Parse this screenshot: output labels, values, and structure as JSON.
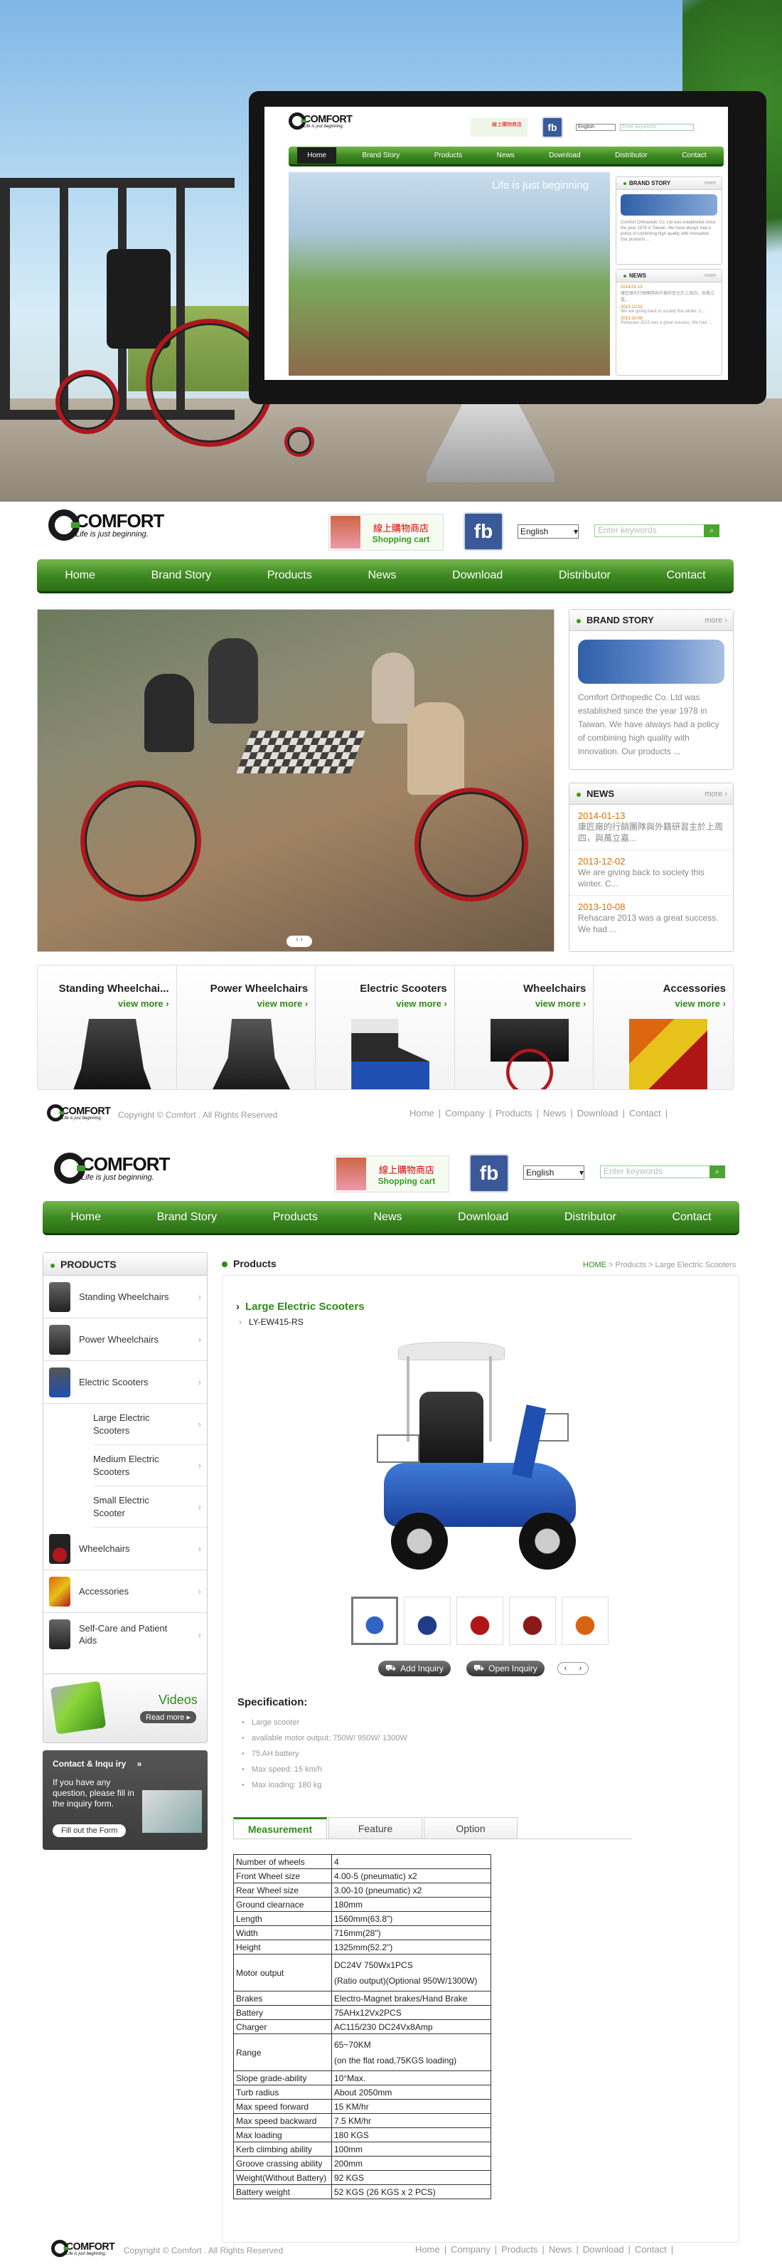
{
  "site": {
    "brand": "COMFORT",
    "slogan": "Life is just beginning.",
    "shop_line1": "線上購物商店",
    "shop_line2": "Shopping cart",
    "fb": "fb",
    "lang": "English",
    "search_placeholder": "Enter keywords"
  },
  "nav": [
    "Home",
    "Brand Story",
    "Products",
    "News",
    "Download",
    "Distributor",
    "Contact"
  ],
  "hero_screen": {
    "banner_text": "Life is just beginning",
    "brand_story": "BRAND STORY",
    "news": "NEWS",
    "more": "more"
  },
  "home": {
    "brand_story_title": "BRAND STORY",
    "more": "more",
    "brand_story_text": "Comfort Orthopedic Co. Ltd was established since the year 1978 in Taiwan. We have always had a policy of combining high quality with innovation. Our products ...",
    "news_title": "NEWS",
    "news": [
      {
        "date": "2014-01-13",
        "text": "康匠廠的行銷團隊與外籍研習主於上周四，與萬立嘉..."
      },
      {
        "date": "2013-12-02",
        "text": "We are giving back to society this winter. C..."
      },
      {
        "date": "2013-10-08",
        "text": "Rehacare 2013 was a great success. We had ..."
      }
    ],
    "categories": [
      {
        "name": "Standing Wheelchai...",
        "view": "view more"
      },
      {
        "name": "Power Wheelchairs",
        "view": "view more"
      },
      {
        "name": "Electric Scooters",
        "view": "view more"
      },
      {
        "name": "Wheelchairs",
        "view": "view more"
      },
      {
        "name": "Accessories",
        "view": "view more"
      }
    ]
  },
  "footer": {
    "copyright": "Copyright © Comfort . All Rights Reserved",
    "links": [
      "Home",
      "Company",
      "Products",
      "News",
      "Download",
      "Contact"
    ]
  },
  "product_page": {
    "sidebar_title": "PRODUCTS",
    "sidebar": [
      {
        "label": "Standing Wheelchairs"
      },
      {
        "label": "Power Wheelchairs"
      },
      {
        "label": "Electric Scooters"
      }
    ],
    "subcategories": [
      "Large Electric Scooters",
      "Medium Electric Scooters",
      "Small Electric Scooter"
    ],
    "sidebar_more": [
      {
        "label": "Wheelchairs"
      },
      {
        "label": "Accessories"
      },
      {
        "label": "Self-Care and Patient Aids"
      }
    ],
    "videos_label": "Videos",
    "read_more": "Read more",
    "contact_title": "Contact & Inqu iry",
    "contact_text": "If you have any question, please fill in the inquiry form.",
    "contact_button": "Fill out the Form",
    "section_title": "Products",
    "breadcrumb_home": "HOME",
    "breadcrumb_rest": " > Products > Large Electric Scooters",
    "product_title": "Large Electric Scooters",
    "model": "LY-EW415-RS",
    "add_inquiry": "Add Inquiry",
    "open_inquiry": "Open Inquiry",
    "spec_title": "Specification:",
    "spec_bullets": [
      "Large scooter",
      "available motor output: 750W/ 950W/ 1300W",
      "75 AH battery",
      "Max speed: 15 km/h",
      "Max loading: 180 kg"
    ],
    "tabs": [
      "Measurement",
      "Feature",
      "Option"
    ],
    "spec_table": [
      [
        "Number of wheels",
        "4"
      ],
      [
        "Front Wheel size",
        "4.00-5 (pneumatic) x2"
      ],
      [
        "Rear Wheel size",
        "3.00-10 (pneumatic) x2"
      ],
      [
        "Ground clearnace",
        "180mm"
      ],
      [
        "Length",
        "1560mm(63.8\")"
      ],
      [
        "Width",
        "716mm(28\")"
      ],
      [
        "Height",
        "1325mm(52.2\")"
      ],
      [
        "Motor output",
        "DC24V 750Wx1PCS\n(Ratio output)(Optional 950W/1300W)"
      ],
      [
        "Brakes",
        "Electro-Magnet brakes/Hand Brake"
      ],
      [
        "Battery",
        "75AHx12Vx2PCS"
      ],
      [
        "Charger",
        "AC115/230 DC24Vx8Amp"
      ],
      [
        "Range",
        "65~70KM\n(on the flat road,75KGS loading)"
      ],
      [
        "Slope grade-ability",
        "10°Max."
      ],
      [
        "Turb radius",
        "About 2050mm"
      ],
      [
        "Max speed forward",
        "15 KM/hr"
      ],
      [
        "Max speed backward",
        "7.5 KM/hr"
      ],
      [
        "Max loading",
        "180 KGS"
      ],
      [
        "Kerb climbing ability",
        "100mm"
      ],
      [
        "Groove crassing ability",
        "200mm"
      ],
      [
        "Weight(Without Battery)",
        "92 KGS"
      ],
      [
        "Battery weight",
        "52 KGS (26 KGS x 2 PCS)"
      ]
    ]
  },
  "colors": {
    "green": "#2f8b17",
    "nav_dark": "#2b6f14",
    "accent_orange": "#e07000",
    "fb_blue": "#3b5998"
  }
}
